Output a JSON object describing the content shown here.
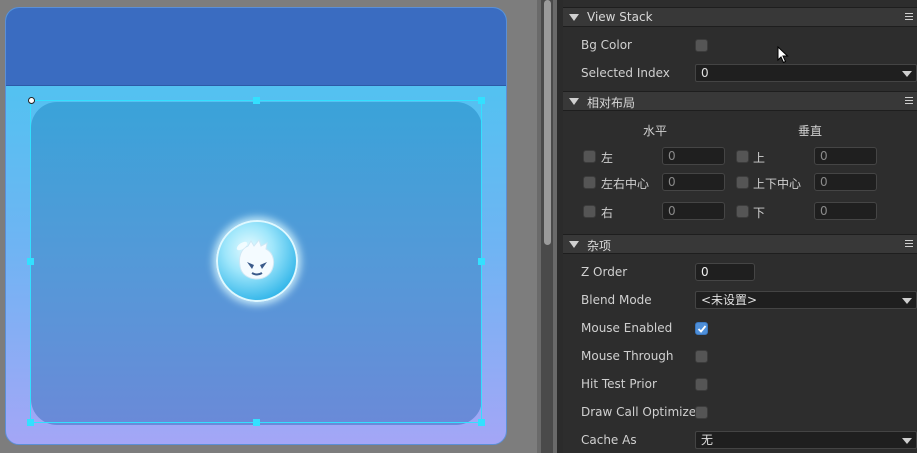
{
  "inspector": {
    "view_stack": {
      "title": "View Stack",
      "bg_color_label": "Bg Color",
      "selected_index_label": "Selected Index",
      "selected_index_value": "0"
    },
    "relative_layout": {
      "title": "相对布局",
      "horizontal_label": "水平",
      "vertical_label": "垂直",
      "left_label": "左",
      "left_value": "0",
      "center_x_label": "左右中心",
      "center_x_value": "0",
      "right_label": "右",
      "right_value": "0",
      "top_label": "上",
      "top_value": "0",
      "center_y_label": "上下中心",
      "center_y_value": "0",
      "bottom_label": "下",
      "bottom_value": "0"
    },
    "misc": {
      "title": "杂项",
      "z_order_label": "Z Order",
      "z_order_value": "0",
      "blend_mode_label": "Blend Mode",
      "blend_mode_value": "<未设置>",
      "mouse_enabled_label": "Mouse Enabled",
      "mouse_through_label": "Mouse Through",
      "hit_test_prior_label": "Hit Test Prior",
      "draw_call_optimize_label": "Draw Call Optimize",
      "cache_as_label": "Cache As",
      "cache_as_value": "无"
    }
  },
  "colors": {
    "header_blue": "#3a6cc1",
    "selection_cyan": "#33e0ff",
    "checkbox_checked": "#4e8fd9"
  },
  "icons": [
    "bubble-character-icon",
    "caret-down-icon",
    "hamburger-menu-icon",
    "checkmark-icon",
    "mouse-cursor-icon"
  ]
}
